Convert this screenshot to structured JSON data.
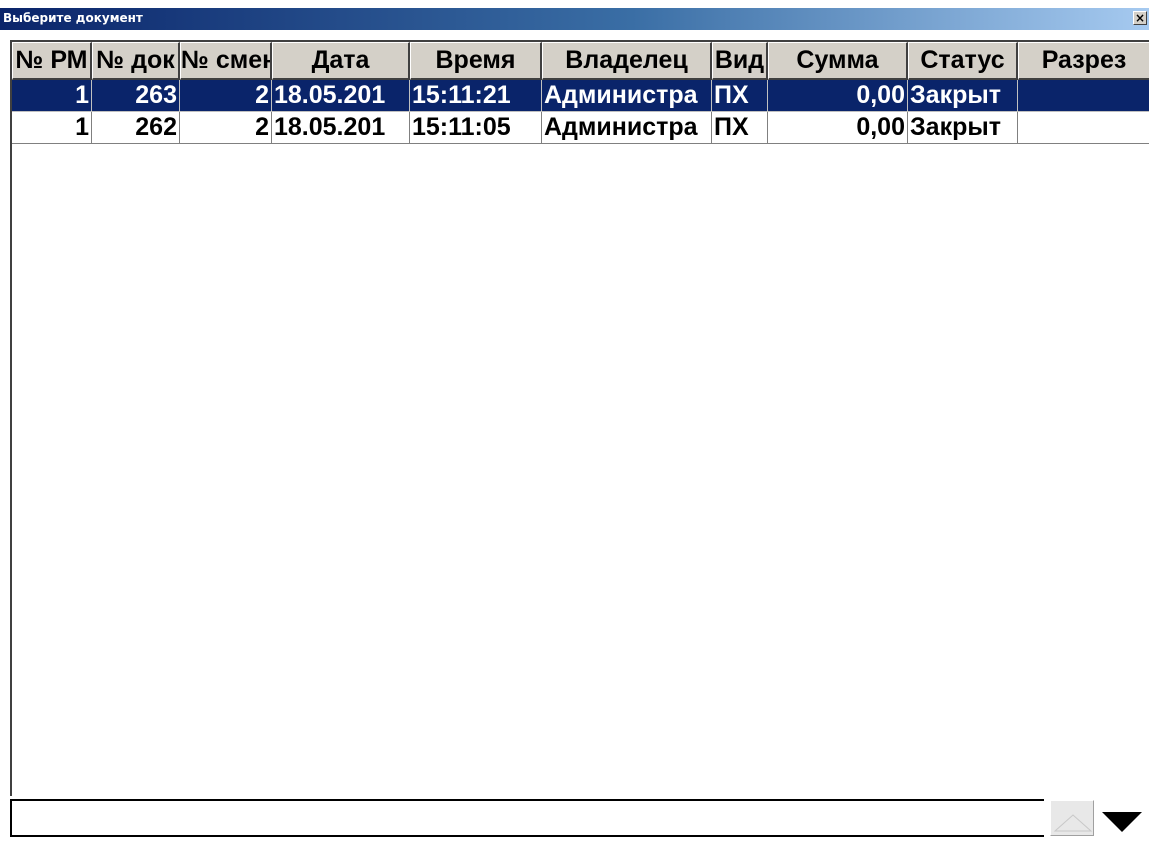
{
  "window": {
    "title": "Выберите документ",
    "close_label": "×"
  },
  "columns": [
    {
      "label": "№ РМ",
      "align": "r"
    },
    {
      "label": "№ док",
      "align": "r"
    },
    {
      "label": "№ смен",
      "align": "r"
    },
    {
      "label": "Дата",
      "align": "l"
    },
    {
      "label": "Время",
      "align": "l"
    },
    {
      "label": "Владелец",
      "align": "l"
    },
    {
      "label": "Вид",
      "align": "l"
    },
    {
      "label": "Сумма",
      "align": "r"
    },
    {
      "label": "Статус",
      "align": "l"
    },
    {
      "label": "Разрез",
      "align": "l"
    }
  ],
  "rows": [
    {
      "selected": true,
      "cells": [
        "1",
        "263",
        "2",
        "18.05.201",
        "15:11:21",
        "Администра",
        "ПХ",
        "0,00",
        "Закрыт",
        ""
      ]
    },
    {
      "selected": false,
      "cells": [
        "1",
        "262",
        "2",
        "18.05.201",
        "15:11:05",
        "Администра",
        "ПХ",
        "0,00",
        "Закрыт",
        ""
      ]
    }
  ],
  "search": {
    "value": ""
  },
  "nav": {
    "up_icon": "triangle-up-icon",
    "down_icon": "triangle-down-icon"
  }
}
